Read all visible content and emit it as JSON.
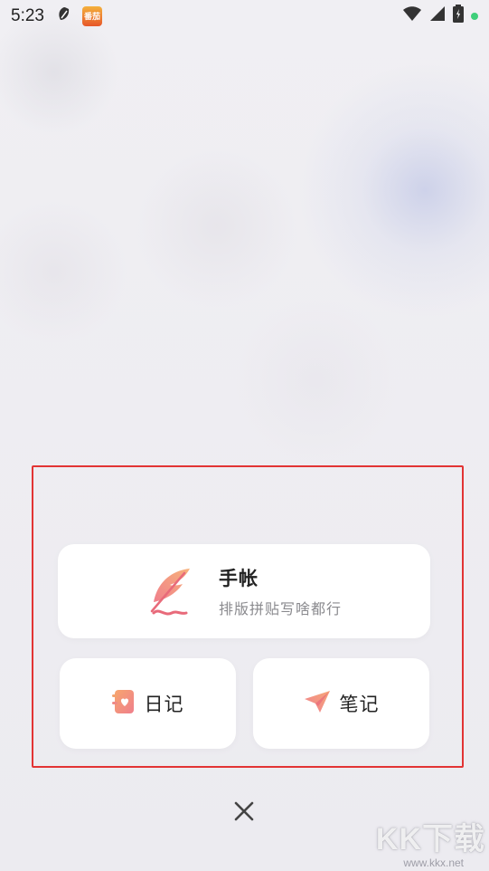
{
  "status_bar": {
    "time": "5:23",
    "app_badge": "番茄",
    "icons": [
      "leaf-icon",
      "app-badge-icon",
      "wifi-icon",
      "signal-icon",
      "battery-icon",
      "green-dot"
    ]
  },
  "menu": {
    "shouzhang": {
      "title": "手帐",
      "subtitle": "排版拼贴写啥都行",
      "icon": "feather-icon"
    },
    "riji": {
      "label": "日记",
      "icon": "diary-icon"
    },
    "biji": {
      "label": "笔记",
      "icon": "paper-plane-icon"
    }
  },
  "close": {
    "icon": "close-icon"
  },
  "watermark": {
    "text": "KK下载",
    "url": "www.kkx.net"
  },
  "colors": {
    "highlight": "#e23434",
    "accent_pink": "#f08a8a",
    "accent_orange": "#f5a06a"
  }
}
